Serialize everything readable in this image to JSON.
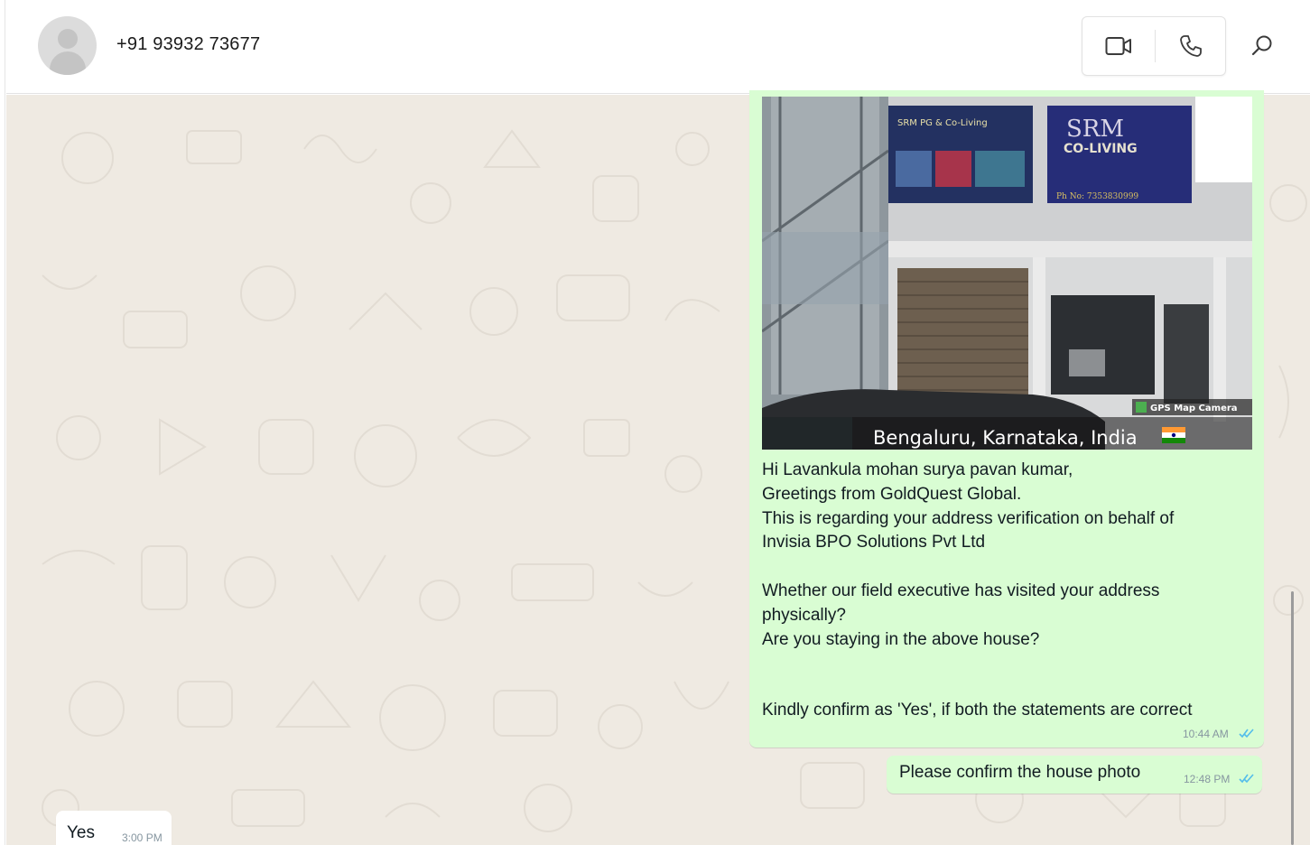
{
  "header": {
    "contact_name": "+91 93932 73677",
    "icons": {
      "avatar": "default-avatar",
      "video": "video-camera-icon",
      "voice": "phone-icon",
      "search": "search-icon"
    }
  },
  "photo": {
    "location": "Bengaluru, Karnataka, India",
    "watermark": "GPS Map Camera",
    "sign_left": "SRM PG & Co-Living",
    "sign_right_title": "SRM",
    "sign_right_sub": "CO-LIVING",
    "sign_right_phone": "Ph No: 7353830999"
  },
  "messages": {
    "main_body": "Hi Lavankula mohan surya pavan kumar,\nGreetings from GoldQuest Global.\nThis is regarding your address verification on behalf of\nInvisia BPO Solutions Pvt Ltd\n\nWhether our field executive has visited your address\nphysically?\nAre you staying in the above house?",
    "main_last_line": "Kindly confirm as 'Yes', if both the statements are correct",
    "main_time": "10:44 AM",
    "second": "Please confirm the house photo",
    "second_time": "12:48 PM",
    "reply": "Yes",
    "reply_time": "3:00 PM"
  },
  "colors": {
    "outgoing_bubble": "#d9fdd3",
    "chat_background": "#efeae2",
    "read_tick": "#53bdeb"
  }
}
